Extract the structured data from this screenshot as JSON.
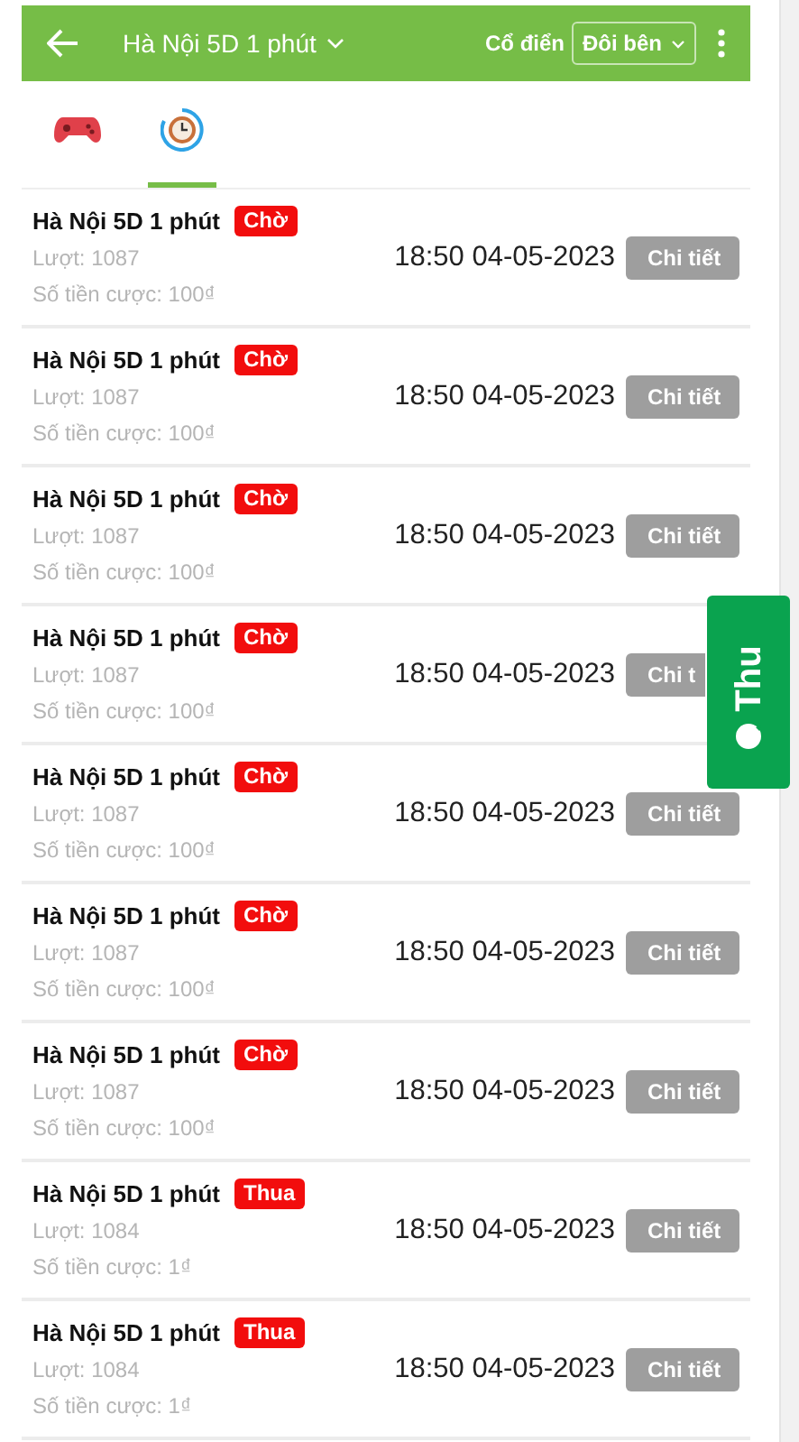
{
  "header": {
    "title": "Hà Nội 5D 1 phút",
    "mode_label": "Cổ điển",
    "mode_select": "Đôi bên"
  },
  "tabs": [
    {
      "kind": "game",
      "selected": false
    },
    {
      "kind": "history",
      "selected": true
    }
  ],
  "bets": [
    {
      "name": "Hà Nội 5D 1 phút",
      "status": "Chờ",
      "round": "Lượt: 1087",
      "amount": "Số tiền cược: 100₫",
      "time": "18:50 04-05-2023",
      "detail": "Chi tiết"
    },
    {
      "name": "Hà Nội 5D 1 phút",
      "status": "Chờ",
      "round": "Lượt: 1087",
      "amount": "Số tiền cược: 100₫",
      "time": "18:50 04-05-2023",
      "detail": "Chi tiết"
    },
    {
      "name": "Hà Nội 5D 1 phút",
      "status": "Chờ",
      "round": "Lượt: 1087",
      "amount": "Số tiền cược: 100₫",
      "time": "18:50 04-05-2023",
      "detail": "Chi tiết"
    },
    {
      "name": "Hà Nội 5D 1 phút",
      "status": "Chờ",
      "round": "Lượt: 1087",
      "amount": "Số tiền cược: 100₫",
      "time": "18:50 04-05-2023",
      "detail": "Chi t",
      "clipped": true
    },
    {
      "name": "Hà Nội 5D 1 phút",
      "status": "Chờ",
      "round": "Lượt: 1087",
      "amount": "Số tiền cược: 100₫",
      "time": "18:50 04-05-2023",
      "detail": "Chi tiết"
    },
    {
      "name": "Hà Nội 5D 1 phút",
      "status": "Chờ",
      "round": "Lượt: 1087",
      "amount": "Số tiền cược: 100₫",
      "time": "18:50 04-05-2023",
      "detail": "Chi tiết"
    },
    {
      "name": "Hà Nội 5D 1 phút",
      "status": "Chờ",
      "round": "Lượt: 1087",
      "amount": "Số tiền cược: 100₫",
      "time": "18:50 04-05-2023",
      "detail": "Chi tiết"
    },
    {
      "name": "Hà Nội 5D 1 phút",
      "status": "Thua",
      "round": "Lượt: 1084",
      "amount": "Số tiền cược: 1₫",
      "time": "18:50 04-05-2023",
      "detail": "Chi tiết"
    },
    {
      "name": "Hà Nội 5D 1 phút",
      "status": "Thua",
      "round": "Lượt: 1084",
      "amount": "Số tiền cược: 1₫",
      "time": "18:50 04-05-2023",
      "detail": "Chi tiết"
    }
  ],
  "float_tab": {
    "label": "Thu"
  }
}
